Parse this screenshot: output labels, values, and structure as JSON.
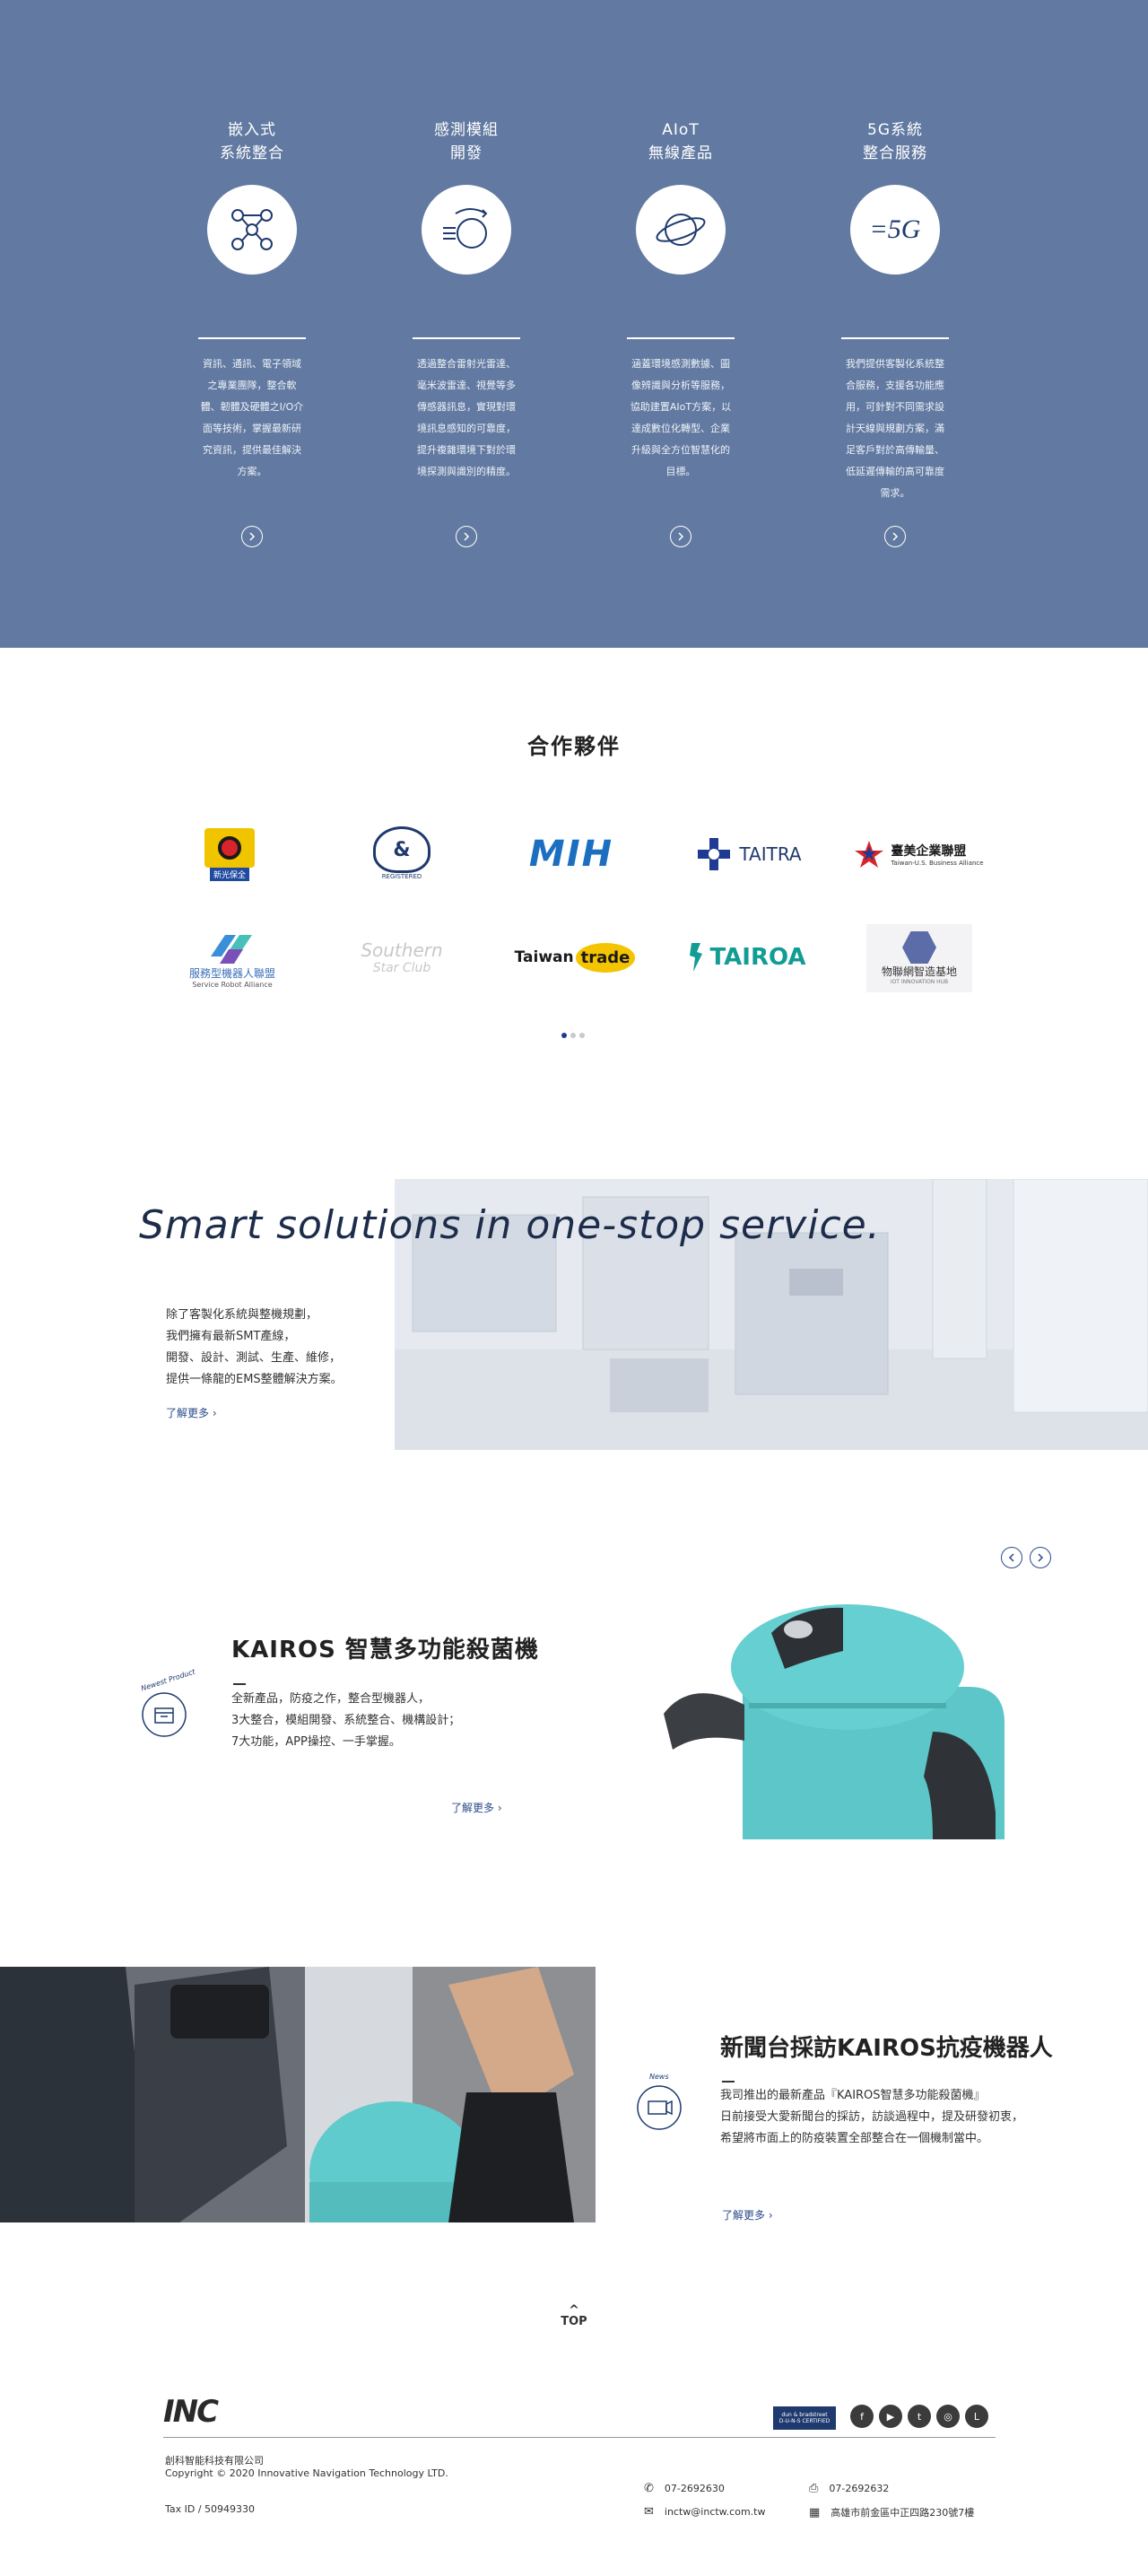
{
  "services": [
    {
      "title": "嵌入式\n系統整合",
      "icon": "network-nodes-icon",
      "desc": "資訊、通訊、電子領域\n之專業團隊，整合軟\n體、韌體及硬體之I/O介\n面等技術，掌握最新研\n究資訊，提供最佳解決\n方案。"
    },
    {
      "title": "感測模組\n開發",
      "icon": "sensor-waves-icon",
      "desc": "透過整合雷射光雷達、\n毫米波雷達、視覺等多\n傳感器訊息，實現對環\n境訊息感知的可靠度，\n提升複雜環境下對於環\n境探測與識別的精度。"
    },
    {
      "title": "AIoT\n無線產品",
      "icon": "planet-icon",
      "desc": "涵蓋環境感測數據、圖\n像辨識與分析等服務，\n協助建置AIoT方案，以\n達成數位化轉型、企業\n升級與全方位智慧化的\n目標。"
    },
    {
      "title": "5G系統\n整合服務",
      "icon": "5g-icon",
      "desc": "我們提供客製化系統整\n合服務，支援各功能應\n用，可針對不同需求設\n計天線與規劃方案，滿\n足客戶對於高傳輸量、\n低延遲傳輸的高可靠度\n需求。"
    }
  ],
  "icon_5g_label": "5G",
  "partners": {
    "title": "合作夥伴",
    "logos": [
      {
        "name": "新光保全",
        "sub": "新光保全"
      },
      {
        "name": "D-U-N-S",
        "sub": "REGISTERED"
      },
      {
        "name": "MIH",
        "sub": ""
      },
      {
        "name": "TAITRA",
        "sub": ""
      },
      {
        "name": "臺美企業聯盟",
        "sub": "Taiwan-U.S. Business Alliance"
      },
      {
        "name": "服務型機器人聯盟",
        "sub": "Service Robot Alliance"
      },
      {
        "name": "Southern",
        "sub": "Star Club"
      },
      {
        "name": "Taiwan",
        "sub": "trade"
      },
      {
        "name": "TAIROA",
        "sub": ""
      },
      {
        "name": "物聯網智造基地",
        "sub": "IOT INNOVATION HUB"
      }
    ],
    "active_page": 1,
    "page_count": 3
  },
  "smart": {
    "title": "Smart solutions in one-stop service.",
    "desc": "除了客製化系統與整機規劃，\n我們擁有最新SMT產線，\n開發、設計、測試、生產、維修，\n提供一條龍的EMS整體解決方案。",
    "more": "了解更多"
  },
  "kairos": {
    "title": "KAIROS 智慧多功能殺菌機",
    "badge": "Newest Product",
    "desc": "全新產品，防疫之作，整合型機器人，\n3大整合，模組開發、系統整合、機構設計；\n7大功能，APP操控、一手掌握。",
    "more": "了解更多"
  },
  "news": {
    "title": "新聞台採訪KAIROS抗疫機器人",
    "badge": "News",
    "desc": "我司推出的最新產品『KAIROS智慧多功能殺菌機』\n日前接受大愛新聞台的採訪，訪談過程中，提及研發初衷，\n希望將市面上的防疫裝置全部整合在一個機制當中。",
    "more": "了解更多"
  },
  "top_label": "TOP",
  "footer": {
    "logo": "INC",
    "company": "創科智能科技有限公司",
    "copyright": "Copyright © 2020 Innovative Navigation Technology LTD.",
    "tax": "Tax ID / 50949330",
    "phone": "07-2692630",
    "fax": "07-2692632",
    "email": "inctw@inctw.com.tw",
    "address": "高雄市前金區中正四路230號7樓",
    "dnb_line1": "dun & bradstreet",
    "dnb_line2": "D-U-N-S CERTIFIED",
    "social": [
      "facebook-icon",
      "youtube-icon",
      "twitter-icon",
      "instagram-icon",
      "line-icon"
    ]
  },
  "colors": {
    "primary": "#627aa1",
    "accent": "#2a4a8a",
    "teal": "#3cc4c4"
  }
}
